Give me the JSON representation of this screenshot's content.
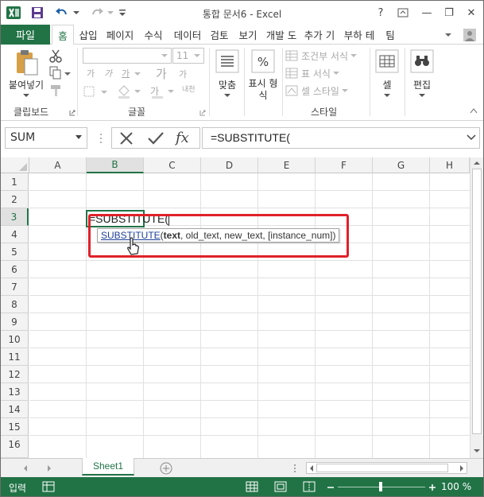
{
  "app": {
    "title": "통합 문서6 - Excel"
  },
  "window_buttons": {
    "help": "?",
    "minimize": "—",
    "restore": "❐",
    "close": "✕"
  },
  "tabs": [
    {
      "label": "파일",
      "active": false
    },
    {
      "label": "홈",
      "active": true
    },
    {
      "label": "삽입"
    },
    {
      "label": "페이지"
    },
    {
      "label": "수식"
    },
    {
      "label": "데이터"
    },
    {
      "label": "검토"
    },
    {
      "label": "보기"
    },
    {
      "label": "개발 도"
    },
    {
      "label": "추가 기"
    },
    {
      "label": "부하 테"
    },
    {
      "label": "팀"
    }
  ],
  "ribbon": {
    "paste_label": "붙여넣기",
    "clipboard_label": "클립보드",
    "font_label": "글꼴",
    "font_size": "11",
    "alignment_label": "맞춤",
    "number_label": "표시 형식",
    "conditional_label": "조건부 서식",
    "table_format_label": "표 서식",
    "cell_style_label": "셀 스타일",
    "style_label": "스타일",
    "cells_label": "셀",
    "editing_label": "편집",
    "font_grow": "가",
    "font_shrink": "가",
    "bold": "가",
    "italic": "가",
    "underline": "가",
    "phonetic": "내천"
  },
  "formula_bar": {
    "name_box": "SUM",
    "formula": "=SUBSTITUTE("
  },
  "columns": [
    "A",
    "B",
    "C",
    "D",
    "E",
    "F",
    "G",
    "H"
  ],
  "rows": [
    "1",
    "2",
    "3",
    "4",
    "5",
    "6",
    "7",
    "8",
    "9",
    "10",
    "11",
    "12",
    "13",
    "14",
    "15",
    "16"
  ],
  "active_cell": {
    "content": "=SUBSTITUTE("
  },
  "tooltip": {
    "function_name": "SUBSTITUTE",
    "open_paren": "(",
    "first_arg": "text",
    "rest_args": ", old_text, new_text, [instance_num])"
  },
  "sheet_tabs": [
    {
      "label": "Sheet1"
    }
  ],
  "status": {
    "mode": "입력",
    "zoom": "100 %"
  },
  "colors": {
    "accent": "#217346",
    "highlight": "#e0212a"
  }
}
